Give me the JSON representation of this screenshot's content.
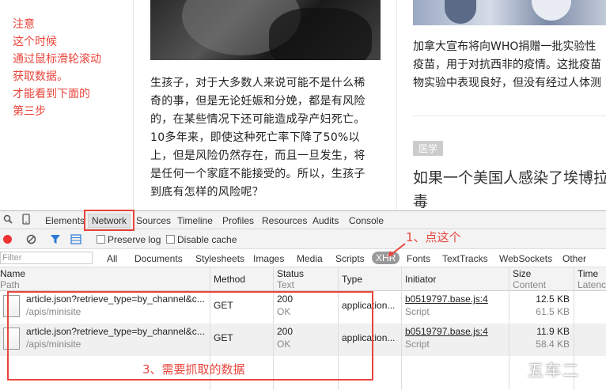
{
  "note": {
    "lines": [
      "注意",
      "这个时候",
      "通过鼠标滑轮滚动",
      "获取数据。",
      "才能看到下面的",
      "第三步"
    ]
  },
  "article1": {
    "lines": [
      "生孩子，对于大多数人来说可能不是什么稀",
      "奇的事，但是无论妊娠和分娩，都是有风险",
      "的，在某些情况下还可能造成孕产妇死亡。",
      "10多年来，即使这种死亡率下降了50%以",
      "上，但是风险仍然存在，而且一旦发生，将",
      "是任何一个家庭不能接受的。所以，生孩子",
      "到底有怎样的风险呢？"
    ]
  },
  "article2": {
    "lines": [
      "加拿大宣布将向WHO捐赠一批实验性",
      "疫苗，用于对抗西非的疫情。这批疫苗",
      "物实验中表现良好，但没有经过人体测"
    ],
    "tag": "医学",
    "headline": [
      "如果一个美国人感染了埃博拉",
      "毒"
    ]
  },
  "devtools": {
    "tabs": [
      "Elements",
      "Network",
      "Sources",
      "Timeline",
      "Profiles",
      "Resources",
      "Audits",
      "Console"
    ],
    "toolbar": {
      "preserve_log": "Preserve log",
      "disable_cache": "Disable cache"
    },
    "filter": {
      "placeholder": "Filter",
      "types": [
        "All",
        "Documents",
        "Stylesheets",
        "Images",
        "Media",
        "Scripts",
        "XHR",
        "Fonts",
        "TextTracks",
        "WebSockets",
        "Other"
      ],
      "selected": "XHR"
    },
    "columns": {
      "name": {
        "main": "Name",
        "sub": "Path"
      },
      "method": {
        "main": "Method"
      },
      "status": {
        "main": "Status",
        "sub": "Text"
      },
      "type": {
        "main": "Type"
      },
      "initiator": {
        "main": "Initiator"
      },
      "size": {
        "main": "Size",
        "sub": "Content"
      },
      "time": {
        "main": "Time",
        "sub": "Latency"
      }
    },
    "rows": [
      {
        "name": "article.json?retrieve_type=by_channel&c...",
        "path": "/apis/minisite",
        "method": "GET",
        "status": "200",
        "status_text": "OK",
        "type": "application...",
        "initiator": "b0519797.base.js:4",
        "initiator_type": "Script",
        "size": "12.5 KB",
        "content": "61.5 KB"
      },
      {
        "name": "article.json?retrieve_type=by_channel&c...",
        "path": "/apis/minisite",
        "method": "GET",
        "status": "200",
        "status_text": "OK",
        "type": "application...",
        "initiator": "b0519797.base.js:4",
        "initiator_type": "Script",
        "size": "11.9 KB",
        "content": "58.4 KB"
      }
    ]
  },
  "annotations": {
    "step1": "1、点这个",
    "step3": "3、需要抓取的数据",
    "color": "#e8453c"
  },
  "watermark": "五车二"
}
